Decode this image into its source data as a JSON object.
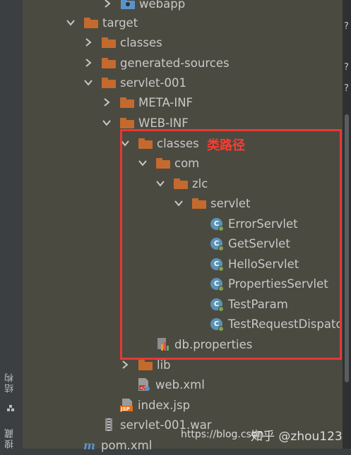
{
  "left_panel": {
    "tabs": [
      {
        "label": "结构"
      },
      {
        "label": "搜藏"
      }
    ]
  },
  "annotation": {
    "text": "类路径",
    "color": "#ff3b30"
  },
  "colors": {
    "folder": "#c46a2e",
    "webapp_folder": "#5a93c9",
    "class_icon": "#5a93b7",
    "highlight_box": "#e53935"
  },
  "tree": {
    "webapp": "webapp",
    "target": "target",
    "classes_top": "classes",
    "generated_sources": "generated-sources",
    "servlet_001": "servlet-001",
    "meta_inf": "META-INF",
    "web_inf": "WEB-INF",
    "classes": "classes",
    "com": "com",
    "zlc": "zlc",
    "servlet": "servlet",
    "class_files": [
      {
        "label": "ErrorServlet",
        "icon": "java-class-icon"
      },
      {
        "label": "GetServlet",
        "icon": "java-class-icon"
      },
      {
        "label": "HelloServlet",
        "icon": "java-class-icon"
      },
      {
        "label": "PropertiesServlet",
        "icon": "java-class-icon"
      },
      {
        "label": "TestParam",
        "icon": "java-class-icon"
      },
      {
        "label": "TestRequestDispato",
        "icon": "java-class-icon"
      }
    ],
    "db_properties": "db.properties",
    "lib": "lib",
    "web_xml": "web.xml",
    "index_jsp": "index.jsp",
    "war": "servlet-001.war",
    "pom": "pom.xml"
  },
  "watermark": {
    "url": "https://blog.csdn",
    "author": "知乎 @zhou123"
  }
}
